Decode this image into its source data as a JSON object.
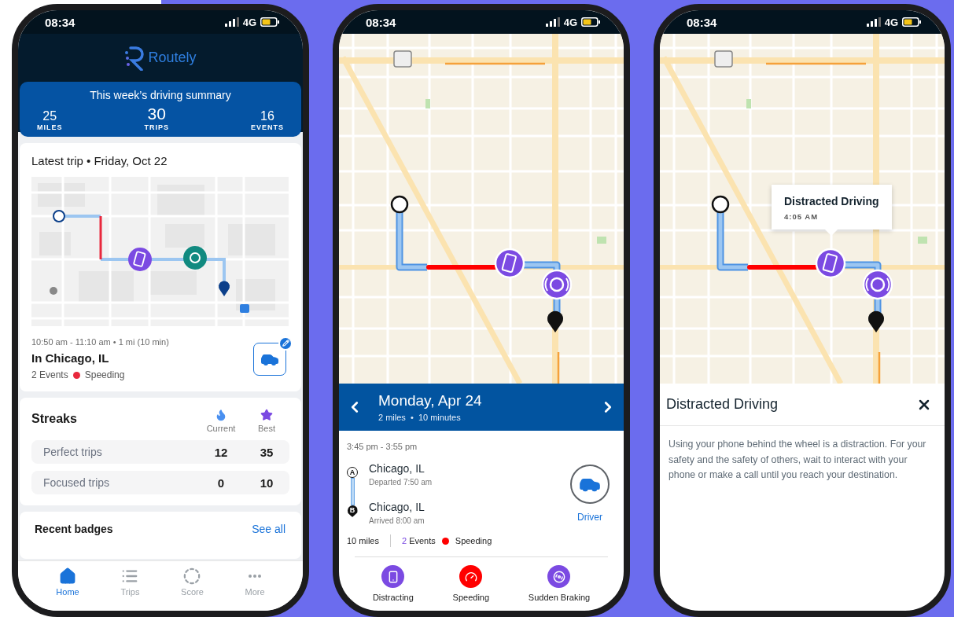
{
  "home_screen": {
    "status_bar": {
      "time": "08:34",
      "network": "4G"
    },
    "app_name": "Routely",
    "summary": {
      "title": "This week’s driving summary",
      "stats": [
        {
          "value": "25",
          "label": "MILES",
          "featured": false
        },
        {
          "value": "30",
          "label": "TRIPS",
          "featured": true
        },
        {
          "value": "16",
          "label": "EVENTS",
          "featured": false
        }
      ]
    },
    "latest_trip": {
      "title": "Latest trip • Friday, Oct 22",
      "time_range": "10:50 am - 11:10 am • 1 mi (10  min)",
      "location": "In Chicago, IL",
      "events": "2 Events",
      "event_tag": {
        "label": "Speeding",
        "color": "#e8283c"
      }
    },
    "streaks": {
      "title": "Streaks",
      "columns": [
        "Current",
        "Best"
      ],
      "rows": [
        {
          "label": "Perfect trips",
          "current": "12",
          "best": "35"
        },
        {
          "label": "Focused trips",
          "current": "0",
          "best": "10"
        }
      ]
    },
    "badges": {
      "title": "Recent badges",
      "link": "See all"
    },
    "nav": [
      {
        "label": "Home",
        "selected": true
      },
      {
        "label": "Trips",
        "selected": false
      },
      {
        "label": "Score",
        "selected": false
      },
      {
        "label": "More",
        "selected": false
      }
    ]
  },
  "trip_screen": {
    "status_bar": {
      "time": "08:34",
      "network": "4G"
    },
    "header": {
      "title": "Monday, Apr 24",
      "subtitle": "2 miles  •  10 minutes"
    },
    "time_range": "3:45 pm - 3:55 pm",
    "stops": [
      {
        "kind": "start",
        "marker": "A",
        "name": "Chicago, IL",
        "detail": "Departed 7:50 am"
      },
      {
        "kind": "end",
        "marker": "B",
        "name": "Chicago, IL",
        "detail": "Arrived 8:00 am"
      }
    ],
    "driver_label": "Driver",
    "distance": "10 miles",
    "events_count": "2",
    "events_label": "Events",
    "event_tag": {
      "label": "Speeding",
      "color": "#ff0000"
    },
    "event_types": [
      {
        "label": "Distracting",
        "color": "#7b4ae2"
      },
      {
        "label": "Speeding",
        "color": "#ff0000"
      },
      {
        "label": "Sudden Braking",
        "color": "#7b4ae2"
      }
    ]
  },
  "event_screen": {
    "status_bar": {
      "time": "08:34",
      "network": "4G"
    },
    "tooltip": {
      "title": "Distracted Driving",
      "time": "4:05 AM"
    },
    "panel": {
      "title": "Distracted Driving",
      "body": "Using your phone behind the wheel is a distraction. For your safety and the safety of others, wait to interact with your phone or make a call until you reach your destination."
    }
  }
}
